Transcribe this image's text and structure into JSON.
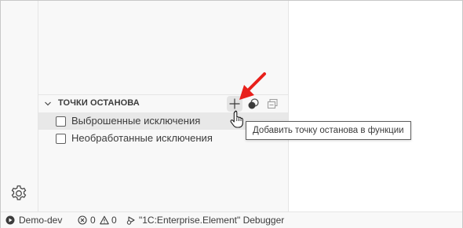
{
  "breakpoints": {
    "title": "ТОЧКИ ОСТАНОВА",
    "items": [
      {
        "label": "Выброшенные исключения",
        "checked": false
      },
      {
        "label": "Необработанные исключения",
        "checked": false
      }
    ]
  },
  "tooltip": {
    "text": "Добавить точку останова в функции"
  },
  "status_bar": {
    "run_label": "Demo-dev",
    "errors": "0",
    "warnings": "0",
    "debugger_label": "\"1C:Enterprise.Element\" Debugger"
  },
  "icons": {
    "activity_bottom": "gear-icon",
    "section_actions": [
      "plus-icon",
      "toggle-breakpoints-icon",
      "collapse-all-icon"
    ],
    "status": [
      "play-circle-icon",
      "error-icon",
      "warning-icon",
      "debug-icon"
    ]
  },
  "colors": {
    "annotation_arrow": "#e8201b",
    "tooltip_border": "#5f5f5f",
    "selected_row": "#e8e8e8"
  }
}
